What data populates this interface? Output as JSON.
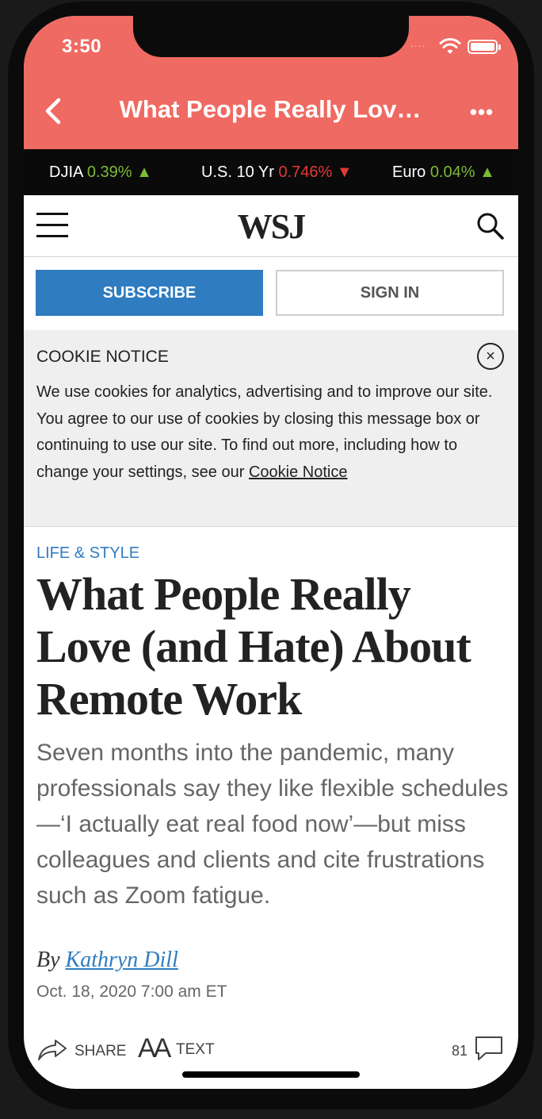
{
  "status_bar": {
    "time": "3:50",
    "signal_dots": "....",
    "icons": [
      "wifi-icon",
      "battery-icon"
    ]
  },
  "nav": {
    "title": "What People Really Lov…",
    "back_icon": "chevron-left-icon",
    "more_label": "•••",
    "bg_color": "#ef6a62"
  },
  "ticker": [
    {
      "name": "DJIA",
      "value": "0.39%",
      "dir": "▲",
      "trend": "up"
    },
    {
      "name": "U.S. 10 Yr",
      "value": "0.746%",
      "dir": "▼",
      "trend": "down"
    },
    {
      "name": "Euro",
      "value": "0.04%",
      "dir": "▲",
      "trend": "up"
    }
  ],
  "masthead": {
    "logo": "WSJ",
    "menu_icon": "hamburger-icon",
    "search_icon": "search-icon"
  },
  "auth": {
    "subscribe_label": "SUBSCRIBE",
    "signin_label": "SIGN IN"
  },
  "cookie": {
    "title": "COOKIE NOTICE",
    "close_label": "×",
    "body": "We use cookies for analytics, advertising and to improve our site. You agree to our use of cookies by closing this message box or continuing to use our site. To find out more, including how to change your settings, see our ",
    "link": "Cookie Notice"
  },
  "article": {
    "section": "LIFE & STYLE",
    "headline": "What People Really Love (and Hate) About Remote Work",
    "dek": "Seven months into the pandemic, many professionals say they like flexible schedules—‘I actually eat real food now’—but miss colleagues and clients and cite frustrations such as Zoom fatigue.",
    "by_prefix": "By",
    "author": "Kathryn Dill",
    "date": "Oct. 18, 2020 7:00 am ET"
  },
  "actions": {
    "share_label": "SHARE",
    "text_icon": "AA",
    "text_label": "TEXT",
    "comment_count": "81"
  },
  "colors": {
    "accent_blue": "#2f7cc0",
    "up_green": "#7cbb34",
    "down_red": "#e23a34"
  }
}
